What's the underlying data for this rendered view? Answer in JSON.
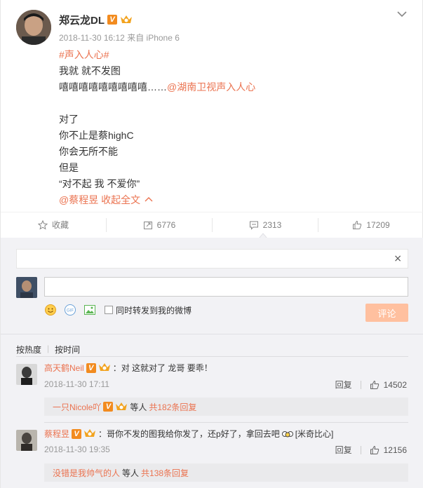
{
  "post": {
    "author": "郑云龙DL",
    "meta": "2018-11-30 16:12 来自 iPhone 6",
    "lines": [
      {
        "parts": [
          {
            "text": "#声入人心#",
            "link": true
          }
        ]
      },
      {
        "parts": [
          {
            "text": "我就 就不发图",
            "link": false
          }
        ]
      },
      {
        "parts": [
          {
            "text": "嘻嘻嘻嘻嘻嘻嘻嘻嘻……",
            "link": false
          },
          {
            "text": "@湖南卫视声入人心",
            "link": true
          }
        ]
      },
      {
        "parts": [
          {
            "text": "",
            "link": false
          }
        ]
      },
      {
        "parts": [
          {
            "text": "对了",
            "link": false
          }
        ]
      },
      {
        "parts": [
          {
            "text": "你不止是蔡highC",
            "link": false
          }
        ]
      },
      {
        "parts": [
          {
            "text": "你会无所不能",
            "link": false
          }
        ]
      },
      {
        "parts": [
          {
            "text": "但是",
            "link": false
          }
        ]
      },
      {
        "parts": [
          {
            "text": "“对不起  我  不爱你”",
            "link": false
          }
        ]
      },
      {
        "parts": [
          {
            "text": "@蔡程昱",
            "link": true
          },
          {
            "text": "  收起全文",
            "link": true
          }
        ]
      }
    ]
  },
  "actions": {
    "favorite": "收藏",
    "repost": "6776",
    "comment": "2313",
    "like": "17209"
  },
  "comment_box": {
    "ad_close": "×",
    "repost_checkbox_label": "同时转发到我的微博",
    "submit": "评论"
  },
  "sort": {
    "by_heat": "按热度",
    "separator": "|",
    "by_time": "按时间"
  },
  "comments": [
    {
      "user": "高天鹤Neil",
      "text": "：对 这就对了 龙哥 要乖！",
      "time": "2018-11-30 17:11",
      "reply": "回复",
      "likes": "14502",
      "sub_user": "一只Nicole吖",
      "sub_text": "等人",
      "sub_count": "共182条回复"
    },
    {
      "user": "蔡程昱",
      "text": "：哥你不发的图我给你发了，还p好了，拿回去吧",
      "text_tail": "[米奇比心]",
      "time": "2018-11-30 19:35",
      "reply": "回复",
      "likes": "12156",
      "sub_user": "没错是我帅气的人",
      "sub_text": "等人",
      "sub_count": "共138条回复"
    }
  ],
  "colors": {
    "link": "#eb7350",
    "verified": "#f28b1f",
    "submit_disabled": "#ffc09f"
  }
}
